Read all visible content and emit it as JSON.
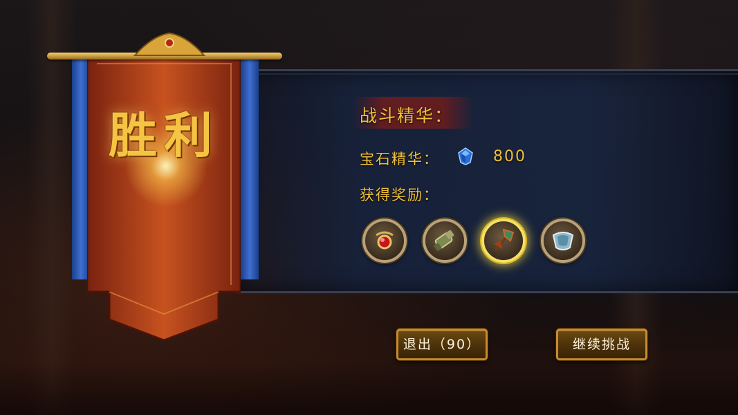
{
  "banner": {
    "title": "胜利"
  },
  "rewards_panel": {
    "section_title": "战斗精华：",
    "gem_essence": {
      "label": "宝石精华：",
      "icon": "blue-gem-icon",
      "value": "800"
    },
    "rewards_label": "获得奖励：",
    "items": [
      {
        "icon": "red-amulet-icon",
        "selected": false
      },
      {
        "icon": "gauntlet-icon",
        "selected": false
      },
      {
        "icon": "axe-icon",
        "selected": true
      },
      {
        "icon": "shoulder-armor-icon",
        "selected": false
      }
    ]
  },
  "buttons": {
    "exit": "退出（90）",
    "continue": "继续挑战"
  },
  "colors": {
    "gold_text": "#f0c13a",
    "button_border": "#c98a2c",
    "panel": "#18243e",
    "banner_red": "#b5421c"
  }
}
